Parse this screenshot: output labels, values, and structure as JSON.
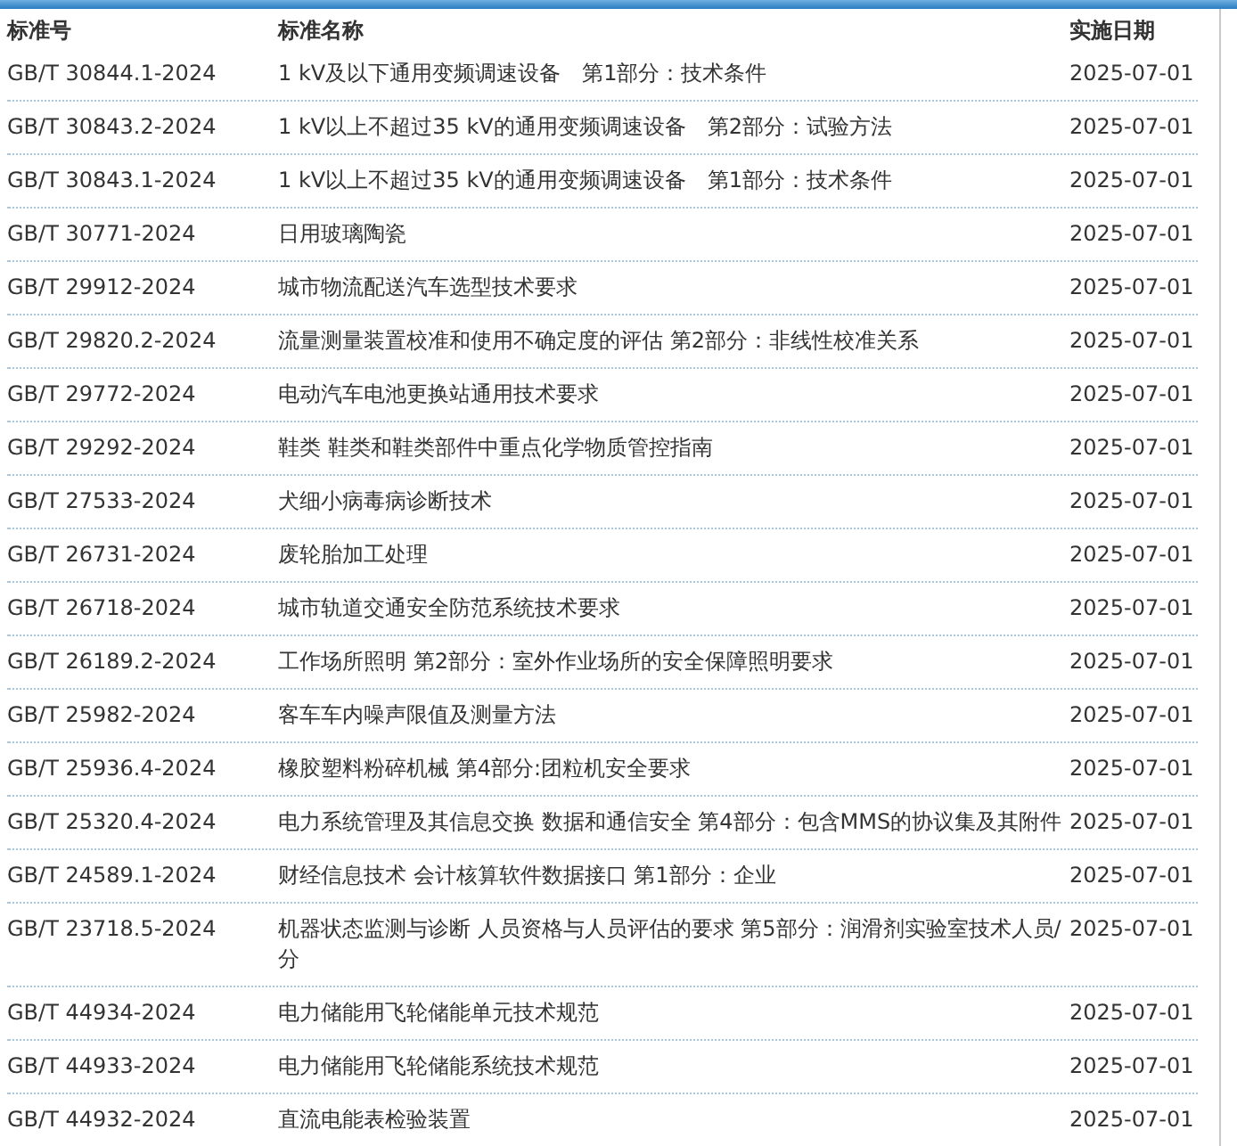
{
  "table": {
    "columns": [
      "标准号",
      "标准名称",
      "实施日期"
    ],
    "rows": [
      [
        "GB/T 30844.1-2024",
        "1 kV及以下通用变频调速设备　第1部分：技术条件",
        "2025-07-01"
      ],
      [
        "GB/T 30843.2-2024",
        "1 kV以上不超过35 kV的通用变频调速设备　第2部分：试验方法",
        "2025-07-01"
      ],
      [
        "GB/T 30843.1-2024",
        "1 kV以上不超过35 kV的通用变频调速设备　第1部分：技术条件",
        "2025-07-01"
      ],
      [
        "GB/T 30771-2024",
        "日用玻璃陶瓷",
        "2025-07-01"
      ],
      [
        "GB/T 29912-2024",
        "城市物流配送汽车选型技术要求",
        "2025-07-01"
      ],
      [
        "GB/T 29820.2-2024",
        "流量测量装置校准和使用不确定度的评估 第2部分：非线性校准关系",
        "2025-07-01"
      ],
      [
        "GB/T 29772-2024",
        "电动汽车电池更换站通用技术要求",
        "2025-07-01"
      ],
      [
        "GB/T 29292-2024",
        "鞋类 鞋类和鞋类部件中重点化学物质管控指南",
        "2025-07-01"
      ],
      [
        "GB/T 27533-2024",
        "犬细小病毒病诊断技术",
        "2025-07-01"
      ],
      [
        "GB/T 26731-2024",
        "废轮胎加工处理",
        "2025-07-01"
      ],
      [
        "GB/T 26718-2024",
        "城市轨道交通安全防范系统技术要求",
        "2025-07-01"
      ],
      [
        "GB/T 26189.2-2024",
        "工作场所照明 第2部分：室外作业场所的安全保障照明要求",
        "2025-07-01"
      ],
      [
        "GB/T 25982-2024",
        "客车车内噪声限值及测量方法",
        "2025-07-01"
      ],
      [
        "GB/T 25936.4-2024",
        "橡胶塑料粉碎机械 第4部分:团粒机安全要求",
        "2025-07-01"
      ],
      [
        "GB/T 25320.4-2024",
        "电力系统管理及其信息交换 数据和通信安全 第4部分：包含MMS的协议集及其附件",
        "2025-07-01"
      ],
      [
        "GB/T 24589.1-2024",
        "财经信息技术 会计核算软件数据接口 第1部分：企业",
        "2025-07-01"
      ],
      [
        "GB/T 23718.5-2024",
        "机器状态监测与诊断 人员资格与人员评估的要求 第5部分：润滑剂实验室技术人员/分",
        "2025-07-01"
      ],
      [
        "GB/T 44934-2024",
        "电力储能用飞轮储能单元技术规范",
        "2025-07-01"
      ],
      [
        "GB/T 44933-2024",
        "电力储能用飞轮储能系统技术规范",
        "2025-07-01"
      ],
      [
        "GB/T 44932-2024",
        "直流电能表检验装置",
        "2025-07-01"
      ]
    ]
  }
}
